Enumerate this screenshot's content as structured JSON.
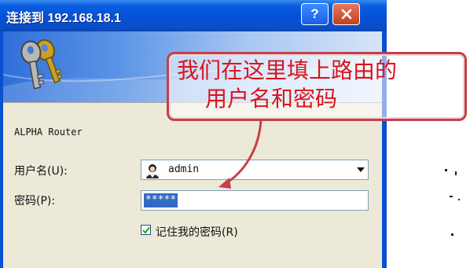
{
  "window": {
    "title": "连接到 192.168.18.1",
    "help_button": "?",
    "close_button": "close"
  },
  "dialog": {
    "router_name": "ALPHA Router",
    "username_label": "用户名(U):",
    "username_value": "admin",
    "password_label": "密码(P):",
    "password_value": "*****",
    "remember_label": "记住我的密码(R)",
    "remember_checked": true
  },
  "annotation": {
    "line1": "我们在这里填上路由的",
    "line2": "用户名和密码",
    "color": "#d8141e"
  },
  "icons": {
    "banner": "keys-icon",
    "user": "user-icon",
    "dropdown": "chevron-down-icon",
    "checkbox": "checkmark-icon"
  },
  "colors": {
    "titlebar": "#0550d6",
    "dialog_bg": "#ece9d8",
    "selection": "#316ac5",
    "callout_border": "#c4404b"
  }
}
